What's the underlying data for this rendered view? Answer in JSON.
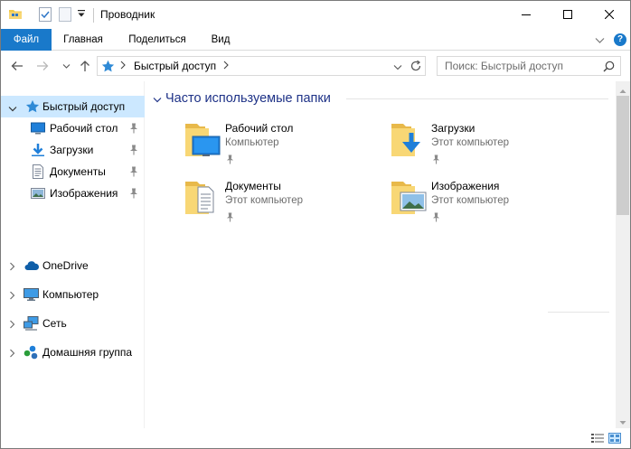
{
  "window": {
    "title": "Проводник"
  },
  "ribbon": {
    "tabs": [
      {
        "label": "Файл",
        "active": true
      },
      {
        "label": "Главная"
      },
      {
        "label": "Поделиться"
      },
      {
        "label": "Вид"
      }
    ],
    "help_label": "?"
  },
  "address_bar": {
    "path": "Быстрый доступ"
  },
  "search": {
    "placeholder": "Поиск: Быстрый доступ"
  },
  "sidebar": {
    "quick_access": {
      "label": "Быстрый доступ",
      "expanded": true,
      "selected": true,
      "items": [
        {
          "label": "Рабочий стол",
          "icon": "desktop-icon",
          "pinned": true
        },
        {
          "label": "Загрузки",
          "icon": "download-icon",
          "pinned": true
        },
        {
          "label": "Документы",
          "icon": "documents-icon",
          "pinned": true
        },
        {
          "label": "Изображения",
          "icon": "pictures-icon",
          "pinned": true
        }
      ]
    },
    "roots": [
      {
        "label": "OneDrive",
        "icon": "onedrive-icon"
      },
      {
        "label": "Компьютер",
        "icon": "computer-icon"
      },
      {
        "label": "Сеть",
        "icon": "network-icon"
      },
      {
        "label": "Домашняя группа",
        "icon": "homegroup-icon"
      }
    ]
  },
  "content": {
    "group_title": "Часто используемые папки",
    "folders": [
      {
        "name": "Рабочий стол",
        "location": "Компьютер",
        "icon": "desktop-folder-icon",
        "pinned": true
      },
      {
        "name": "Загрузки",
        "location": "Этот компьютер",
        "icon": "downloads-folder-icon",
        "pinned": true
      },
      {
        "name": "Документы",
        "location": "Этот компьютер",
        "icon": "documents-folder-icon",
        "pinned": true
      },
      {
        "name": "Изображения",
        "location": "Этот компьютер",
        "icon": "pictures-folder-icon",
        "pinned": true
      }
    ]
  },
  "colors": {
    "accent": "#1979ca",
    "selection": "#cce8ff",
    "group_title": "#1e3287",
    "folder": "#f8d775"
  }
}
